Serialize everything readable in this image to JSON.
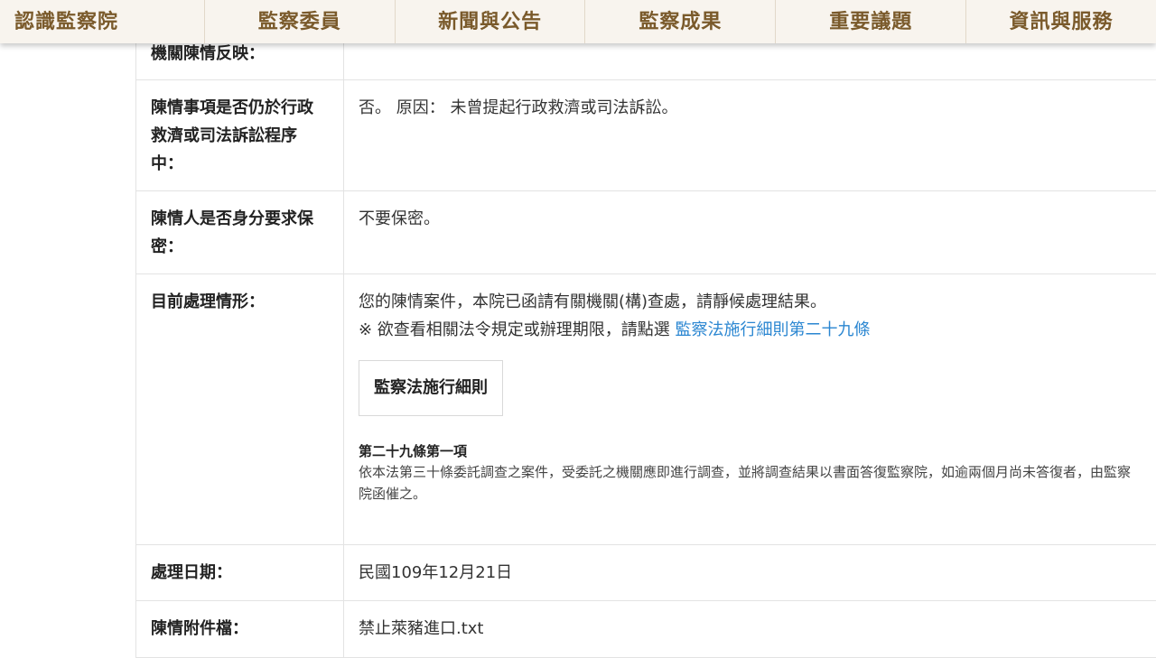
{
  "nav": {
    "items": [
      "認識監察院",
      "監察委員",
      "新聞與公告",
      "監察成果",
      "重要議題",
      "資訊與服務"
    ]
  },
  "rows": {
    "r1": {
      "label": "機關陳情反映：",
      "value": ""
    },
    "r2": {
      "label": "陳情事項是否仍於行政救濟或司法訴訟程序中：",
      "value": "否。 原因： 未曾提起行政救濟或司法訴訟。"
    },
    "r3": {
      "label": "陳情人是否身分要求保密：",
      "value": "不要保密。"
    },
    "r4": {
      "label": "目前處理情形：",
      "status": "您的陳情案件，本院已函請有關機關(構)查處，請靜候處理結果。",
      "note_prefix": "※ 欲查看相關法令規定或辦理期限，請點選",
      "note_link": "監察法施行細則第二十九條",
      "law_button": "監察法施行細則",
      "law_title": "第二十九條第一項",
      "law_text": "依本法第三十條委託調查之案件，受委託之機關應即進行調查，並將調查結果以書面答復監察院，如逾兩個月尚未答復者，由監察院函催之。"
    },
    "r5": {
      "label": "處理日期：",
      "value": "民國109年12月21日"
    },
    "r6": {
      "label": "陳情附件檔：",
      "value": "禁止萊豬進口.txt"
    }
  },
  "colors": {
    "nav_bg": "#f8f4ee",
    "nav_text": "#7a5a2b",
    "link": "#2a86d1"
  }
}
